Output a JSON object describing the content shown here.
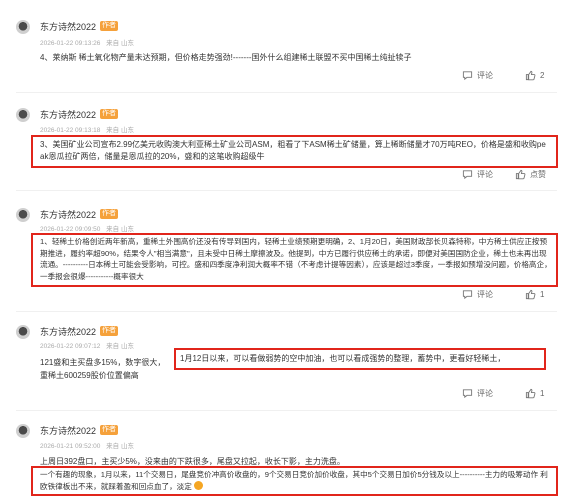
{
  "posts": [
    {
      "author": "东方诗然2022",
      "tag": "作者",
      "date": "2026-01-22 09:13:26",
      "source": "来自 山东",
      "body": "4、莱纳斯 稀土氧化物产量未达预期，但价格走势强劲!-------国外什么组建稀土联盟不买中国稀土纯扯犊子",
      "comment_label": "评论",
      "like_label": "2"
    },
    {
      "author": "东方诗然2022",
      "tag": "作者",
      "date": "2026-01-22 09:13:18",
      "source": "来自 山东",
      "body": "3、美国矿业公司宣布2.99亿美元收购澳大利亚稀土矿业公司ASM，粗看了下ASM稀土矿储量，算上稀断储量才70万吨REO，价格是盛和收购peak恩瓜拉矿两倍，储量是恩瓜拉的20%，盛和的这笔收购超级牛",
      "comment_label": "评论",
      "like_label": "点赞"
    },
    {
      "author": "东方诗然2022",
      "tag": "作者",
      "date": "2026-01-22 09:09:50",
      "source": "来自 山东",
      "body": "1、轻稀土价格创近两年新高，重稀土外围高价还没有传导到国内，轻稀土业绩预期更明确，2、1月20日，美国财政部长贝森特称，中方稀土供应正按预期推进，履约率超90%，结果令人\"相当满意\"，且未受中日稀土摩擦波及。他提到，中方已履行供应稀土的承诺，即便对美国国防企业，稀土也未再出现流通。----------日本稀土可能会受影响，可控。盛和四季度净利润大概率不错（不考虑计提等因素），应该是超过3季度，一季报如预增没问题，价格高企，一季报会很爆-----------概率很大",
      "comment_label": "评论",
      "like_label": "1"
    },
    {
      "author": "东方诗然2022",
      "tag": "作者",
      "date": "2026-01-22 09:07:12",
      "source": "来自 山东",
      "body_a": "121盛和主买盘多15%，数字很大，",
      "body_b": "1月12日以来，可以看做弱势的空中加油，也可以看成强势的整理，蓄势中，更看好轻稀土，",
      "body_c": "重稀土600259股价位置偏高",
      "comment_label": "评论",
      "like_label": "1"
    },
    {
      "author": "东方诗然2022",
      "tag": "作者",
      "date": "2026-01-21 09:52:00",
      "source": "来自 山东",
      "body_a": "上周日392盘口，主买少5%，没来由的下跌很多，尾盘又拉起，收长下影，主力洗盘。",
      "body_b": "一个有趣的现象，1月以来，11个交易日，尾盘竞价冲高价收盘的，9个交易日竞价加价收盘，其中5个交易日加价5分钱及以上----------主力的吸筹动作 利欧铁律板出不来，就踩着盈和回点血了，淡定"
    }
  ]
}
